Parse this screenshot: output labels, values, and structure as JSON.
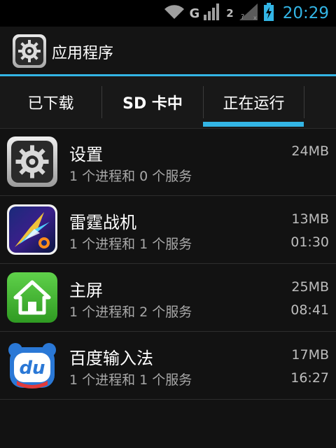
{
  "status_bar": {
    "network_label": "G",
    "sim2_label": "2",
    "time": "20:29",
    "accent": "#33b5e5"
  },
  "action_bar": {
    "title": "应用程序",
    "icon": "settings-gear-icon"
  },
  "tabs": [
    {
      "label": "已下载",
      "selected": false
    },
    {
      "label": "SD 卡中",
      "selected": false
    },
    {
      "label": "正在运行",
      "selected": true
    }
  ],
  "apps": [
    {
      "name": "设置",
      "subtitle": "1 个进程和 0 个服务",
      "memory": "24MB",
      "time": "",
      "icon": "settings-gear-icon"
    },
    {
      "name": "雷霆战机",
      "subtitle": "1 个进程和 1 个服务",
      "memory": "13MB",
      "time": "01:30",
      "icon": "game-jet-icon"
    },
    {
      "name": "主屏",
      "subtitle": "1 个进程和 2 个服务",
      "memory": "25MB",
      "time": "08:41",
      "icon": "home-icon"
    },
    {
      "name": "百度输入法",
      "subtitle": "1 个进程和 1 个服务",
      "memory": "17MB",
      "time": "16:27",
      "icon": "baidu-input-icon"
    }
  ]
}
